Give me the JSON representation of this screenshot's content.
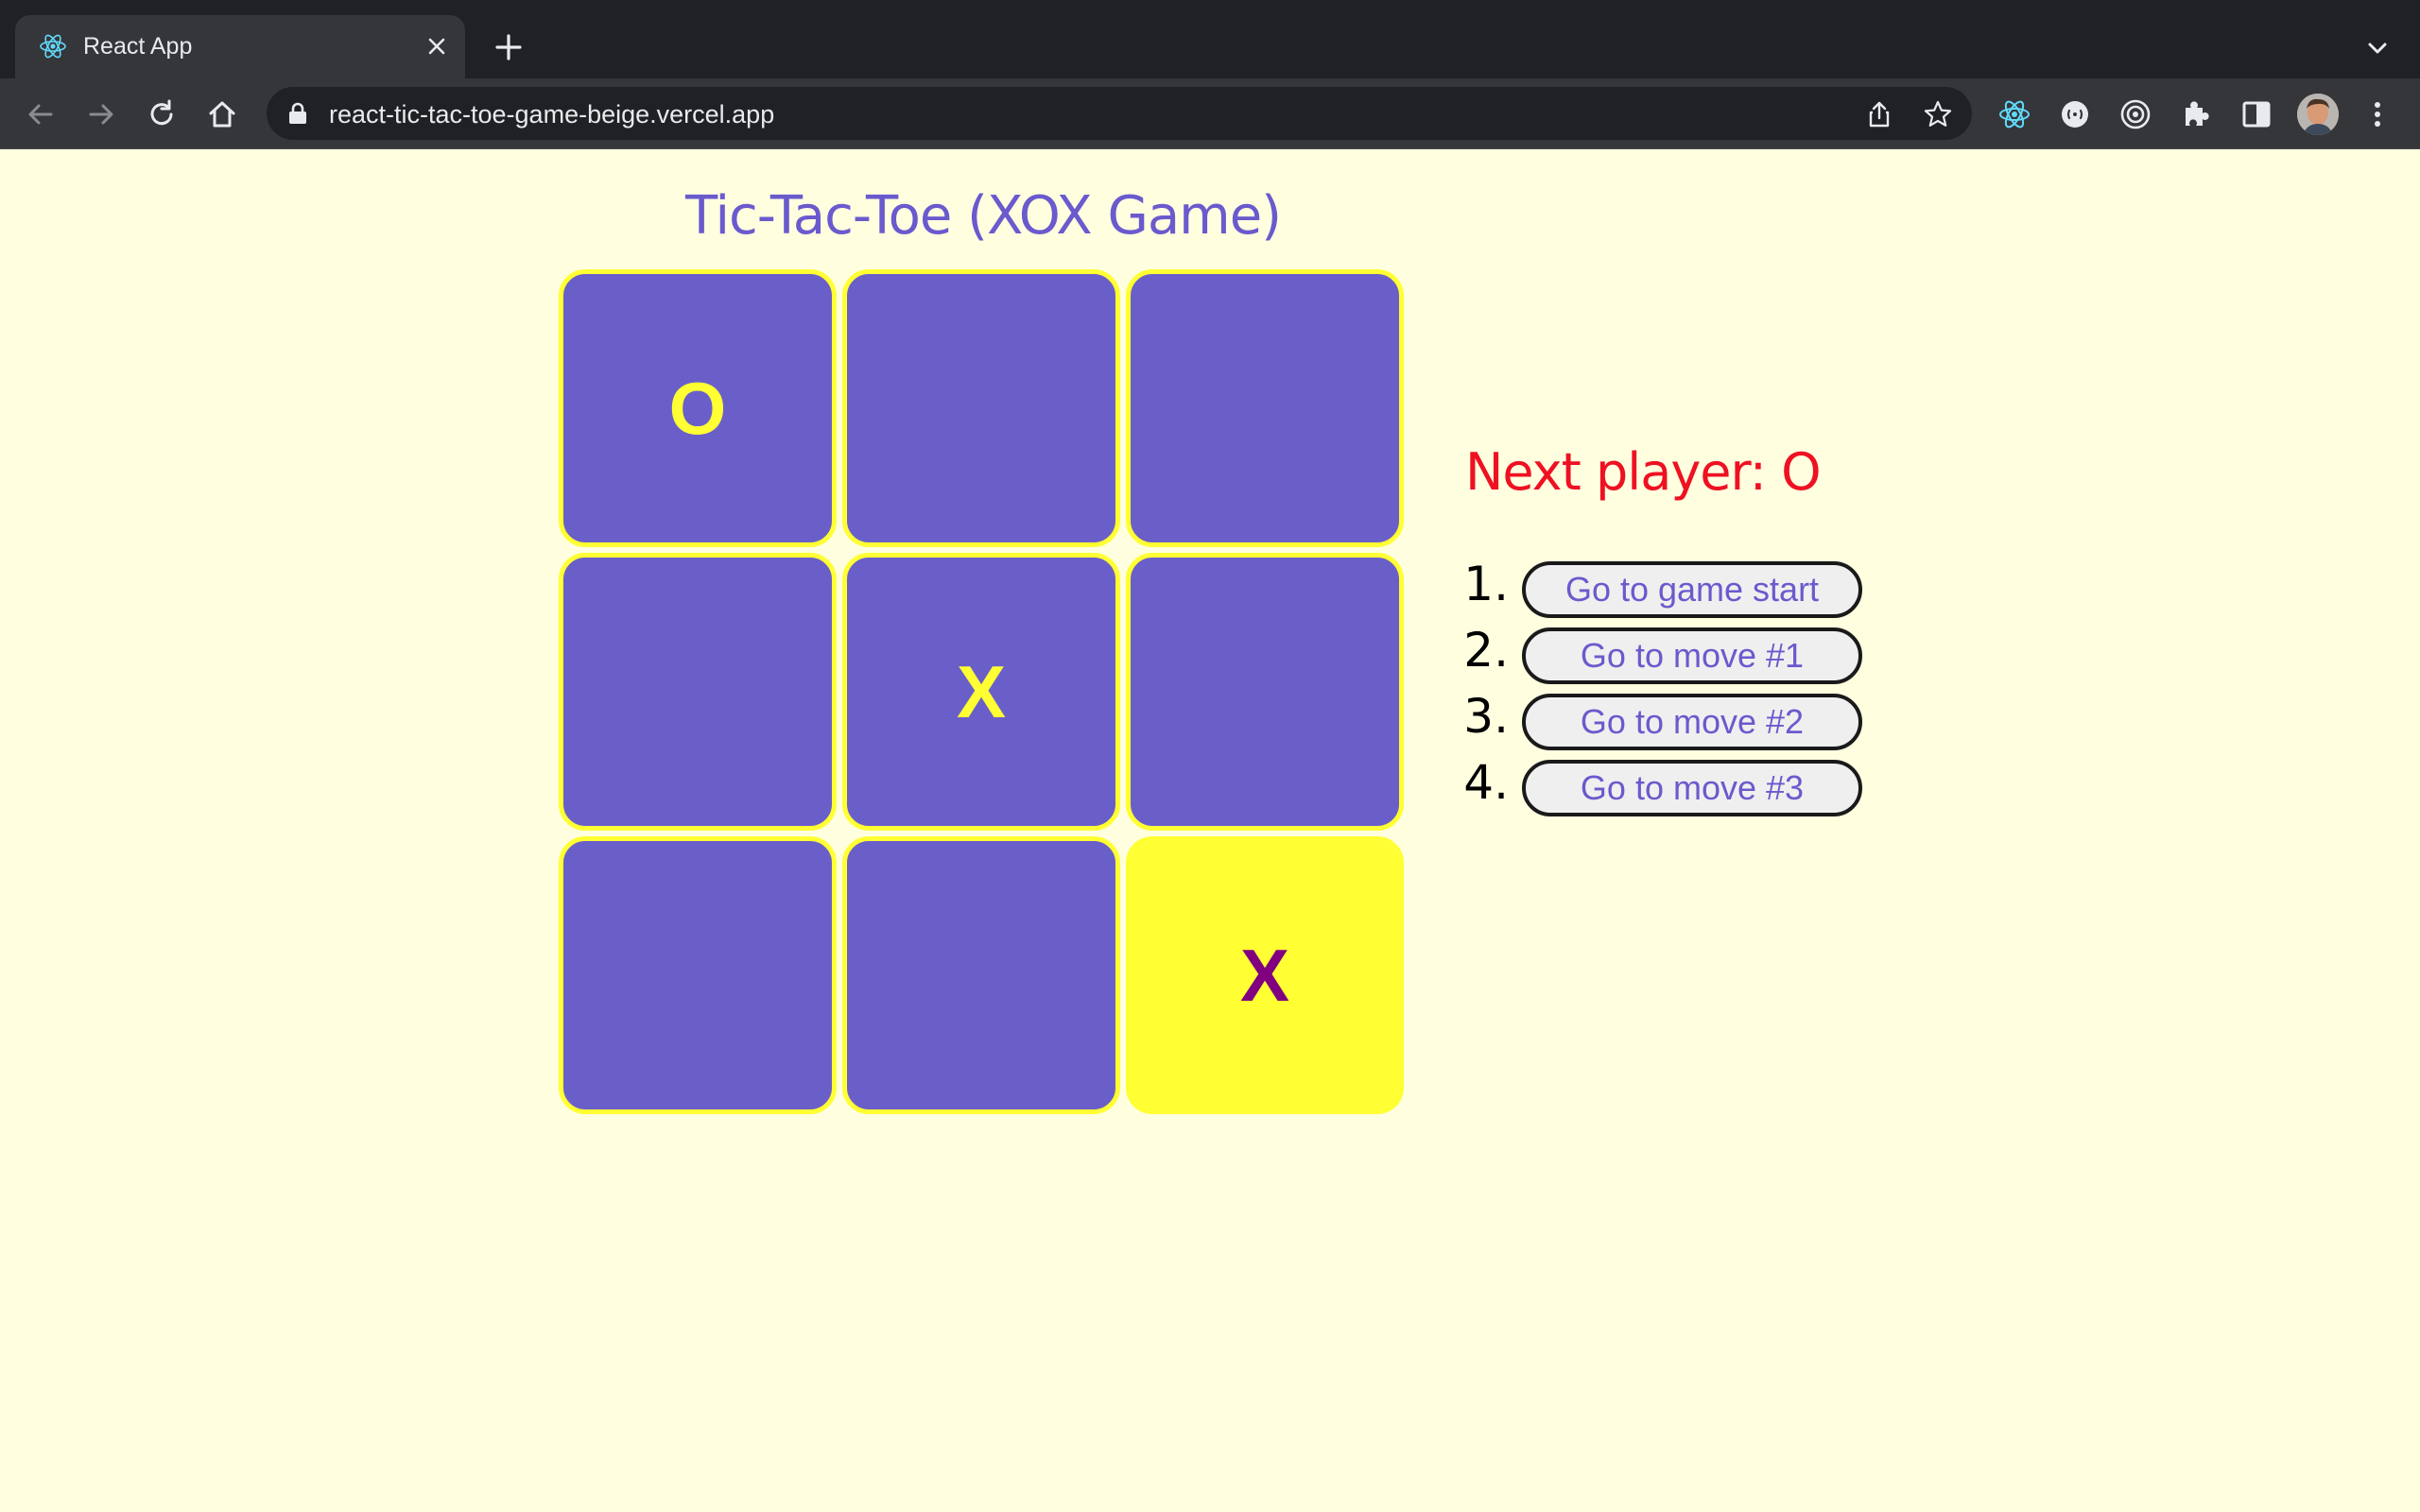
{
  "browser": {
    "tab_title": "React App",
    "url": "react-tic-tac-toe-game-beige.vercel.app",
    "colors": {
      "chrome_dark": "#202124",
      "chrome_toolbar": "#35363a",
      "react_blue": "#61dafb"
    }
  },
  "game": {
    "title": "Tic-Tac-Toe (XOX Game)",
    "board": [
      {
        "value": "O",
        "highlighted": false
      },
      {
        "value": "",
        "highlighted": false
      },
      {
        "value": "",
        "highlighted": false
      },
      {
        "value": "",
        "highlighted": false
      },
      {
        "value": "X",
        "highlighted": false
      },
      {
        "value": "",
        "highlighted": false
      },
      {
        "value": "",
        "highlighted": false
      },
      {
        "value": "",
        "highlighted": false
      },
      {
        "value": "X",
        "highlighted": true
      }
    ],
    "status": "Next player: O",
    "moves": [
      {
        "number": "1.",
        "label": "Go to game start"
      },
      {
        "number": "2.",
        "label": "Go to move #1"
      },
      {
        "number": "3.",
        "label": "Go to move #2"
      },
      {
        "number": "4.",
        "label": "Go to move #3"
      }
    ],
    "colors": {
      "background": "#ffffe0",
      "square": "#6a5fc9",
      "square_border": "#ffff33",
      "mark": "#ffff33",
      "highlight_square": "#ffff33",
      "highlight_mark": "#800080",
      "title": "#6a5acd",
      "status": "#ee1122"
    }
  }
}
